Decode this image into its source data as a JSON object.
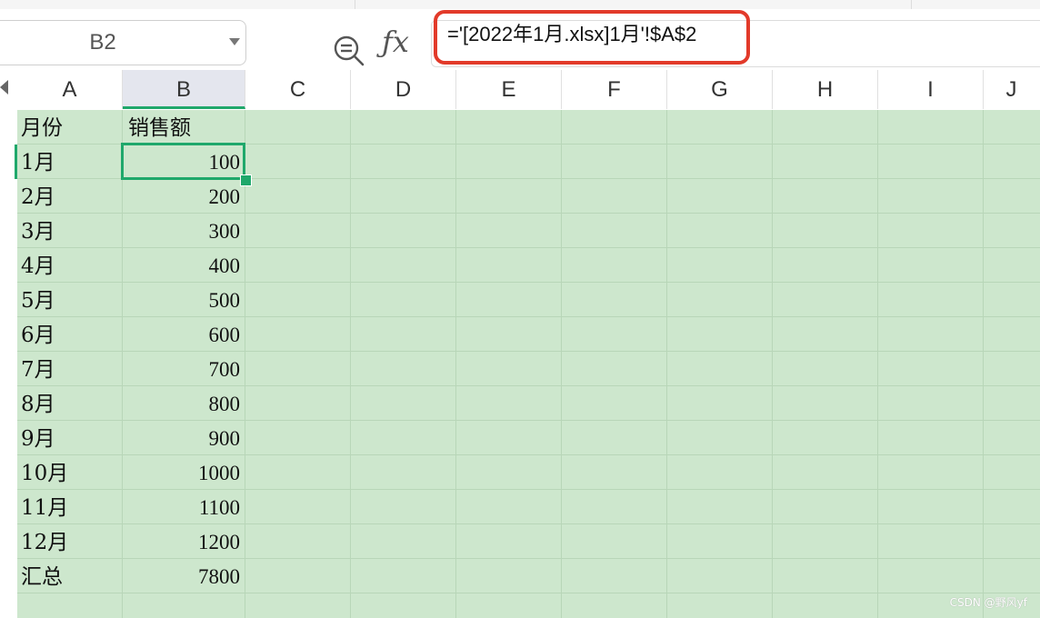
{
  "name_box": {
    "ref": "B2"
  },
  "formula_bar": {
    "text": "='[2022年1月.xlsx]1月'!$A$2"
  },
  "columns": [
    "A",
    "B",
    "C",
    "D",
    "E",
    "F",
    "G",
    "H",
    "I",
    "J"
  ],
  "selected_column": "B",
  "rows": [
    {
      "month": "月份",
      "amount": "销售额"
    },
    {
      "month": "1月",
      "amount": "100"
    },
    {
      "month": "2月",
      "amount": "200"
    },
    {
      "month": "3月",
      "amount": "300"
    },
    {
      "month": "4月",
      "amount": "400"
    },
    {
      "month": "5月",
      "amount": "500"
    },
    {
      "month": "6月",
      "amount": "600"
    },
    {
      "month": "7月",
      "amount": "700"
    },
    {
      "month": "8月",
      "amount": "800"
    },
    {
      "month": "9月",
      "amount": "900"
    },
    {
      "month": "10月",
      "amount": "1000"
    },
    {
      "month": "11月",
      "amount": "1100"
    },
    {
      "month": "12月",
      "amount": "1200"
    },
    {
      "month": "汇总",
      "amount": "7800"
    }
  ],
  "colors": {
    "accent": "#1fa86b",
    "sheet_bg": "#cde7cd",
    "highlight": "#e23a2a"
  },
  "watermark": "CSDN @野风yf"
}
